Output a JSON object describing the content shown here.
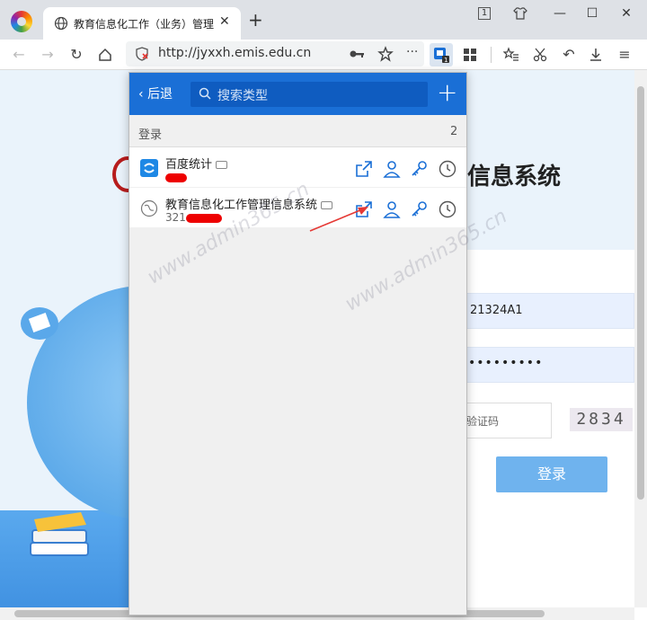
{
  "browser": {
    "tab_title": "教育信息化工作（业务）管理",
    "tab_close": "✕",
    "new_tab": "+",
    "win_badge": "1",
    "window_controls": [
      "—",
      "☐",
      "✕"
    ]
  },
  "address_bar": {
    "url": "http://jyxxh.emis.edu.cn",
    "more": "···"
  },
  "page": {
    "system_title": "信息系统",
    "username_value": "21324A1",
    "password_value": "•••••••••",
    "captcha_placeholder": "验证码",
    "captcha_text": "2834",
    "login_button": "登录",
    "watermark": "www.admin365.cn"
  },
  "password_manager": {
    "back_label": "后退",
    "search_placeholder": "搜索类型",
    "add": "+",
    "section_label": "登录",
    "section_count": "2",
    "entries": [
      {
        "name": "百度统计",
        "sub": ""
      },
      {
        "name": "教育信息化工作管理信息系统",
        "sub": "321"
      }
    ]
  },
  "colors": {
    "accent": "#1a6fd6",
    "login_button": "#6fb3ee",
    "annotation_arrow": "#e53935"
  }
}
